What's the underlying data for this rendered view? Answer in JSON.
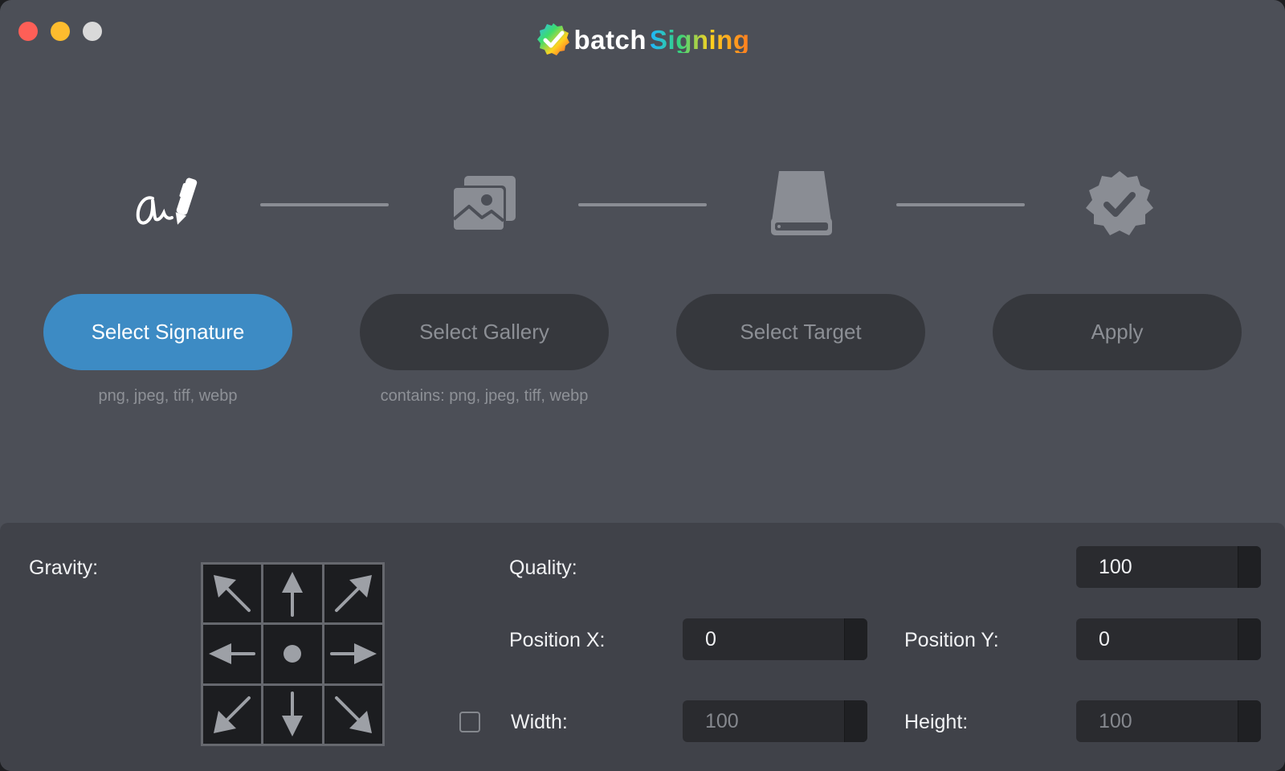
{
  "app": {
    "logo_part1": "batch",
    "logo_part2": "Signing"
  },
  "window_controls": [
    "close",
    "minimize",
    "zoom"
  ],
  "steps": [
    {
      "label": "Select Signature",
      "hint": "png, jpeg, tiff, webp",
      "icon": "signature-icon",
      "active": true
    },
    {
      "label": "Select Gallery",
      "hint": "contains: png, jpeg, tiff, webp",
      "icon": "gallery-icon",
      "active": false
    },
    {
      "label": "Select Target",
      "hint": "",
      "icon": "drive-icon",
      "active": false
    },
    {
      "label": "Apply",
      "hint": "",
      "icon": "checkmark-badge-icon",
      "active": false
    }
  ],
  "settings": {
    "gravity_label": "Gravity:",
    "gravity_options": [
      "north-west",
      "north",
      "north-east",
      "west",
      "center",
      "east",
      "south-west",
      "south",
      "south-east"
    ],
    "quality_label": "Quality:",
    "quality_value": "100",
    "position_x_label": "Position X:",
    "position_x_value": "0",
    "position_y_label": "Position Y:",
    "position_y_value": "0",
    "width_label": "Width:",
    "width_value": "100",
    "height_label": "Height:",
    "height_value": "100",
    "size_checkbox_checked": false
  },
  "colors": {
    "window_bg": "#4c4f57",
    "panel_bg": "#404249",
    "accent": "#3d8bc4",
    "button_inactive": "#36383d"
  }
}
